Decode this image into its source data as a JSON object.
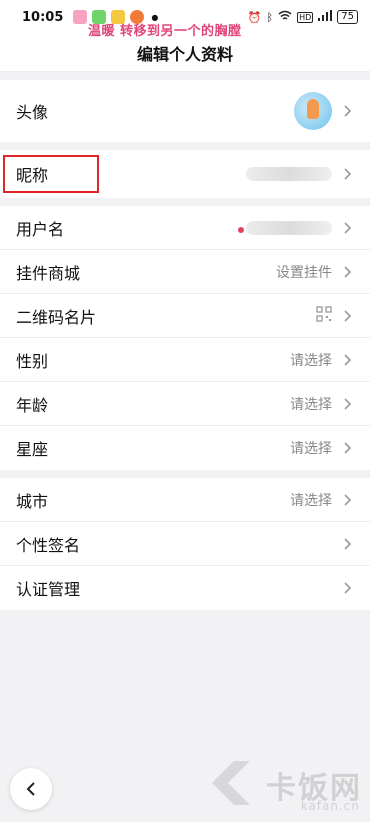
{
  "status_bar": {
    "time": "10:05",
    "battery": "75",
    "song": "温暖 转移到另一个的胸膛",
    "icons": [
      "alarm-icon",
      "bluetooth-icon",
      "wifi-icon",
      "hd-icon",
      "signal-icon"
    ]
  },
  "header": {
    "title": "编辑个人资料"
  },
  "group1": {
    "avatar_label": "头像"
  },
  "group2": {
    "nickname_label": "昵称"
  },
  "group3": {
    "rows": [
      {
        "label": "用户名",
        "value": ""
      },
      {
        "label": "挂件商城",
        "value": "设置挂件"
      },
      {
        "label": "二维码名片",
        "value": ""
      },
      {
        "label": "性别",
        "value": "请选择"
      },
      {
        "label": "年龄",
        "value": "请选择"
      },
      {
        "label": "星座",
        "value": "请选择"
      }
    ]
  },
  "group4": {
    "rows": [
      {
        "label": "城市",
        "value": "请选择"
      },
      {
        "label": "个性签名",
        "value": ""
      },
      {
        "label": "认证管理",
        "value": ""
      }
    ]
  },
  "watermark": {
    "brand": "卡饭网",
    "url": "kafan.cn"
  },
  "colors": {
    "highlight": "#e0252a",
    "song": "#e0457a"
  }
}
